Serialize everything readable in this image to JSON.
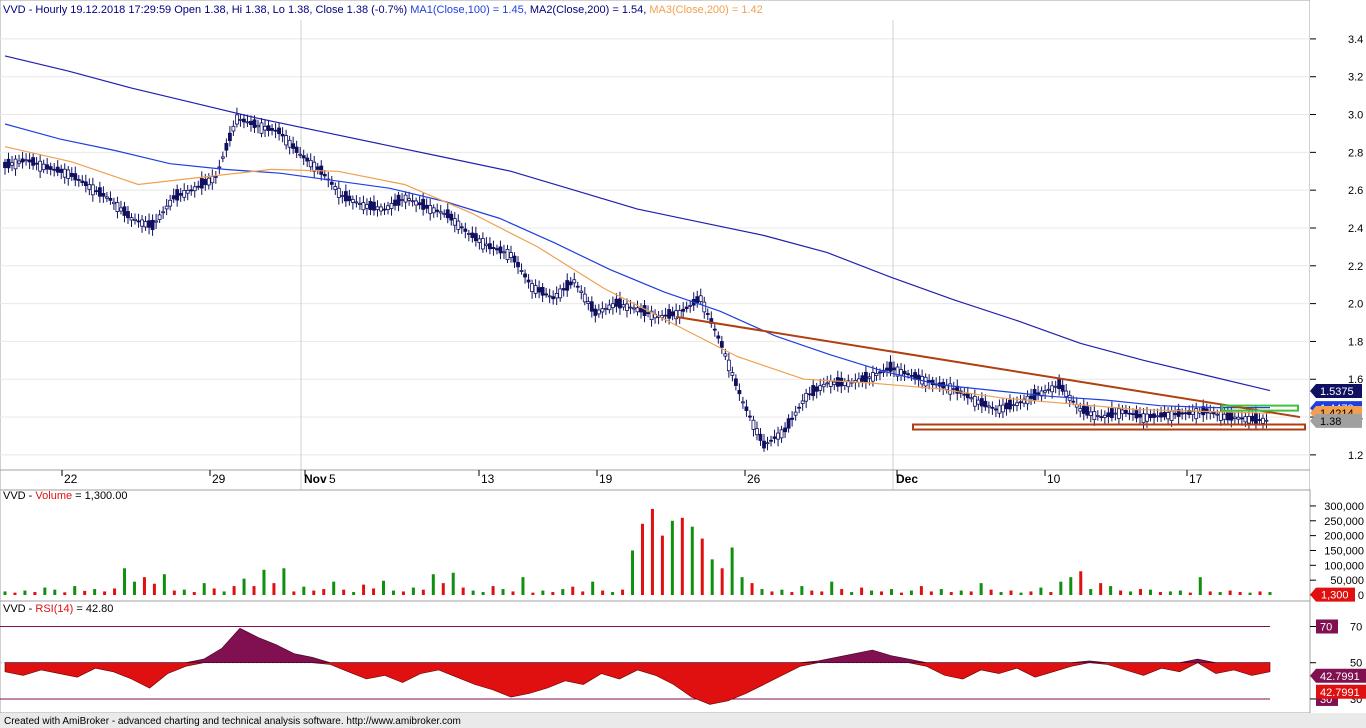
{
  "header": {
    "symbol": "VVD",
    "price_info": " - Hourly 19.12.2018 17:29:59 Open 1.38, Hi 1.38, Lo 1.38, Close 1.38 (-0.7%) ",
    "ma1_label": "MA1(Close,100) = 1.45,",
    "ma2_label": " MA2(Close,200) = 1.54,",
    "ma3_label": " MA3(Close,200) = 1.42"
  },
  "volume_header": {
    "prefix": "VVD - ",
    "name": "Volume",
    "value": " = 1,300.00"
  },
  "rsi_header": {
    "prefix": "VVD - ",
    "name": "RSI(14)",
    "value": " = 42.80"
  },
  "footer": "Created with AmiBroker - advanced charting and technical analysis software. http://www.amibroker.com",
  "colors": {
    "ma1": "#1f3fe0",
    "ma2": "#2020b0",
    "ma3": "#f0a050",
    "trendline": "#b04010",
    "support": "#b04010",
    "resistance_box": "#40c040",
    "bar_up": "#109010",
    "bar_down": "#e01010",
    "rsi_fill": "#e01010",
    "rsi_fill_high": "#801050",
    "rsi_band": "#801050",
    "candle": "#101060"
  },
  "chart_data": [
    {
      "type": "line",
      "name": "price",
      "x_tick_labels": [
        "22",
        "29",
        "Nov",
        "5",
        "13",
        "19",
        "26",
        "Dec",
        "10",
        "17"
      ],
      "y_ticks": [
        1.2,
        1.4,
        1.6,
        1.8,
        2.0,
        2.2,
        2.4,
        2.6,
        2.8,
        3.0,
        3.2,
        3.4
      ],
      "ylim": [
        1.12,
        3.5
      ],
      "series": [
        {
          "name": "Close",
          "values": [
            2.73,
            2.76,
            2.72,
            2.69,
            2.62,
            2.55,
            2.45,
            2.41,
            2.56,
            2.61,
            2.67,
            2.98,
            2.94,
            2.91,
            2.79,
            2.7,
            2.57,
            2.52,
            2.5,
            2.56,
            2.51,
            2.47,
            2.37,
            2.3,
            2.26,
            2.09,
            2.03,
            2.12,
            1.95,
            2.0,
            1.97,
            1.93,
            1.95,
            2.03,
            1.78,
            1.48,
            1.25,
            1.33,
            1.51,
            1.58,
            1.58,
            1.61,
            1.66,
            1.62,
            1.58,
            1.55,
            1.49,
            1.44,
            1.47,
            1.52,
            1.57,
            1.44,
            1.4,
            1.43,
            1.4,
            1.41,
            1.42,
            1.43,
            1.4,
            1.39,
            1.38
          ]
        },
        {
          "name": "MA1(Close,100)",
          "values": [
            2.95,
            2.87,
            2.81,
            2.74,
            2.71,
            2.69,
            2.65,
            2.61,
            2.54,
            2.45,
            2.32,
            2.18,
            2.06,
            1.96,
            1.83,
            1.73,
            1.64,
            1.57,
            1.54,
            1.51,
            1.49,
            1.46,
            1.45,
            1.45
          ]
        },
        {
          "name": "MA2(Close,200)",
          "values": [
            3.31,
            3.23,
            3.14,
            3.06,
            2.98,
            2.91,
            2.84,
            2.77,
            2.7,
            2.6,
            2.5,
            2.43,
            2.36,
            2.27,
            2.14,
            2.02,
            1.91,
            1.79,
            1.7,
            1.62,
            1.54
          ]
        },
        {
          "name": "MA3(Close,200)",
          "values": [
            2.83,
            2.75,
            2.63,
            2.67,
            2.71,
            2.7,
            2.63,
            2.48,
            2.3,
            2.08,
            1.9,
            1.72,
            1.6,
            1.58,
            1.55,
            1.5,
            1.47,
            1.44,
            1.43,
            1.42
          ]
        }
      ],
      "trendline": {
        "start": 1.93,
        "end": 1.4
      },
      "support_level": 1.35,
      "resistance_box_level": 1.45,
      "value_labels": [
        "1.5375",
        "1.4473",
        "1.4214",
        "1.38"
      ]
    },
    {
      "type": "bar",
      "name": "Volume",
      "y_ticks": [
        "300,000",
        "250,000",
        "200,000",
        "150,000",
        "100,000",
        "50,000",
        "0"
      ],
      "ylim": [
        0,
        320000
      ],
      "last_value_label": "1,300",
      "values": [
        12000,
        8000,
        15000,
        10000,
        25000,
        18000,
        9000,
        30000,
        14000,
        20000,
        12000,
        22000,
        90000,
        45000,
        60000,
        38000,
        70000,
        15000,
        18000,
        10000,
        40000,
        22000,
        12000,
        30000,
        55000,
        30000,
        85000,
        40000,
        90000,
        12000,
        28000,
        15000,
        20000,
        45000,
        18000,
        10000,
        35000,
        22000,
        48000,
        15000,
        12000,
        25000,
        18000,
        70000,
        40000,
        75000,
        25000,
        15000,
        10000,
        30000,
        20000,
        12000,
        60000,
        8000,
        15000,
        10000,
        20000,
        28000,
        12000,
        45000,
        15000,
        10000,
        18000,
        150000,
        240000,
        290000,
        200000,
        250000,
        260000,
        230000,
        190000,
        120000,
        90000,
        160000,
        60000,
        40000,
        20000,
        12000,
        18000,
        10000,
        30000,
        15000,
        12000,
        45000,
        20000,
        10000,
        25000,
        15000,
        12000,
        20000,
        8000,
        15000,
        30000,
        12000,
        20000,
        10000,
        15000,
        12000,
        40000,
        18000,
        10000,
        15000,
        8000,
        12000,
        25000,
        10000,
        45000,
        60000,
        80000,
        20000,
        40000,
        30000,
        15000,
        12000,
        20000,
        18000,
        10000,
        12000,
        15000,
        8000,
        60000,
        12000,
        10000,
        15000,
        10000,
        8000,
        12000,
        10000
      ],
      "up": [
        true,
        false,
        true,
        false,
        true,
        true,
        false,
        true,
        false,
        true,
        false,
        false,
        true,
        true,
        false,
        false,
        true,
        false,
        true,
        false,
        true,
        false,
        true,
        false,
        true,
        false,
        true,
        false,
        true,
        false,
        true,
        false,
        false,
        true,
        false,
        true,
        false,
        false,
        true,
        true,
        false,
        true,
        false,
        true,
        false,
        true,
        false,
        true,
        true,
        false,
        true,
        false,
        true,
        false,
        true,
        false,
        true,
        false,
        false,
        true,
        false,
        true,
        false,
        true,
        false,
        false,
        false,
        true,
        false,
        true,
        false,
        true,
        false,
        true,
        true,
        false,
        true,
        false,
        true,
        false,
        true,
        false,
        false,
        true,
        false,
        true,
        false,
        true,
        false,
        true,
        false,
        true,
        false,
        false,
        true,
        false,
        true,
        false,
        true,
        false,
        true,
        false,
        true,
        false,
        true,
        false,
        true,
        true,
        false,
        true,
        false,
        true,
        false,
        true,
        false,
        true,
        false,
        true,
        true,
        false,
        true,
        false,
        true,
        false,
        false,
        true,
        false,
        true
      ]
    },
    {
      "type": "area",
      "name": "RSI(14)",
      "y_ticks": [
        "70",
        "50",
        "30"
      ],
      "ylim": [
        25,
        78
      ],
      "last_value_labels": [
        "42.7991",
        "42.7991"
      ],
      "values": [
        45,
        43,
        46,
        44,
        42,
        47,
        45,
        41,
        36,
        44,
        48,
        52,
        58,
        69,
        64,
        60,
        55,
        53,
        49,
        45,
        41,
        43,
        39,
        44,
        46,
        42,
        38,
        35,
        31,
        33,
        36,
        40,
        38,
        44,
        41,
        46,
        43,
        38,
        31,
        27,
        29,
        33,
        38,
        43,
        48,
        51,
        53,
        55,
        57,
        54,
        52,
        48,
        43,
        41,
        46,
        44,
        47,
        42,
        45,
        48,
        51,
        49,
        46,
        43,
        47,
        45,
        52,
        44,
        46,
        43,
        45
      ]
    }
  ]
}
